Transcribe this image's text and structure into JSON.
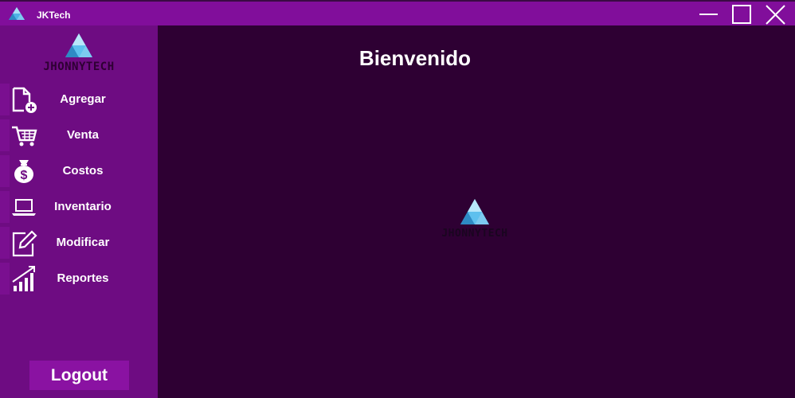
{
  "window": {
    "title": "JKTech",
    "icon": "triangle-logo-icon",
    "controls": [
      "minimize-icon",
      "maximize-icon",
      "close-icon"
    ]
  },
  "sidebar": {
    "logo_text": "JHONNYTECH",
    "items": [
      {
        "label": "Agregar",
        "icon": "add-file-icon"
      },
      {
        "label": "Venta",
        "icon": "cart-icon"
      },
      {
        "label": "Costos",
        "icon": "money-bag-icon"
      },
      {
        "label": "Inventario",
        "icon": "laptop-icon"
      },
      {
        "label": "Modificar",
        "icon": "edit-icon"
      },
      {
        "label": "Reportes",
        "icon": "chart-growth-icon"
      }
    ],
    "logout_label": "Logout"
  },
  "main": {
    "title": "Bienvenido",
    "logo_text": "JHONNYTECH"
  },
  "colors": {
    "titlebar": "#810e9b",
    "sidebar": "#6e0c82",
    "main_bg": "#2e0033",
    "logout_bg": "#8a12a2",
    "logo_blue": "#4fb3e6"
  }
}
